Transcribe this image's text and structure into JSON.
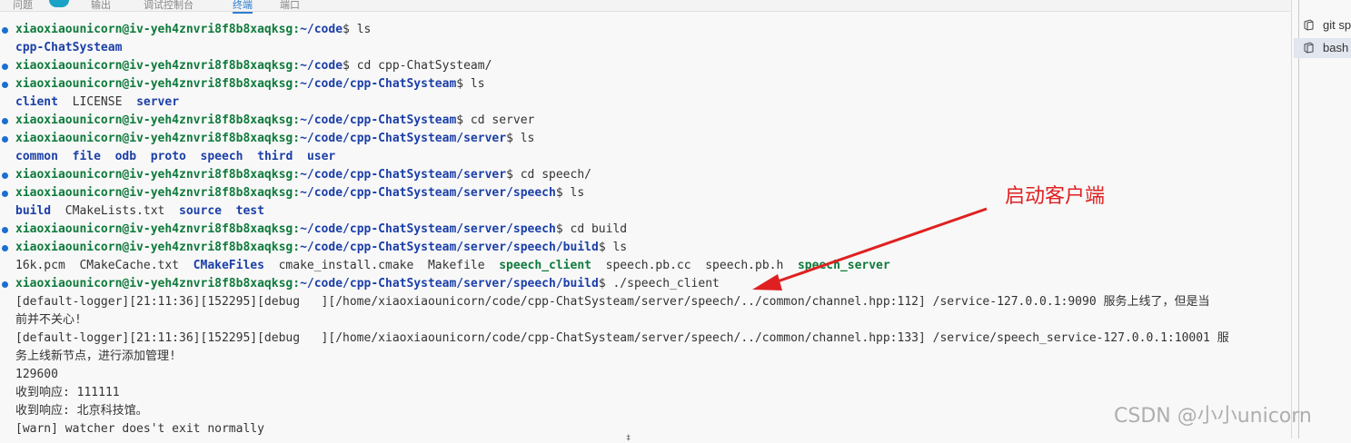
{
  "top_tabs": [
    {
      "label": "问题"
    },
    {
      "label": "输出"
    },
    {
      "label": "调试控制台"
    },
    {
      "label": "终端"
    },
    {
      "label": "端口"
    }
  ],
  "prompt": {
    "user": "xiaoxiaounicorn@iv-yeh4znvri8f8b8xaqksg",
    "sep": ":"
  },
  "lines": [
    {
      "type": "cmd",
      "path": "~/code",
      "cmd": "$ ls"
    },
    {
      "type": "out",
      "parts": [
        {
          "t": "cpp-ChatSysteam",
          "c": "dir"
        }
      ]
    },
    {
      "type": "cmd",
      "path": "~/code",
      "cmd": "$ cd cpp-ChatSysteam/"
    },
    {
      "type": "cmd",
      "path": "~/code/cpp-ChatSysteam",
      "cmd": "$ ls"
    },
    {
      "type": "out",
      "parts": [
        {
          "t": "client",
          "c": "dir"
        },
        {
          "t": "  LICENSE  ",
          "c": "plain"
        },
        {
          "t": "server",
          "c": "dir"
        }
      ]
    },
    {
      "type": "cmd",
      "path": "~/code/cpp-ChatSysteam",
      "cmd": "$ cd server"
    },
    {
      "type": "cmd",
      "path": "~/code/cpp-ChatSysteam/server",
      "cmd": "$ ls"
    },
    {
      "type": "out",
      "parts": [
        {
          "t": "common",
          "c": "dir"
        },
        {
          "t": "  ",
          "c": "plain"
        },
        {
          "t": "file",
          "c": "dir"
        },
        {
          "t": "  ",
          "c": "plain"
        },
        {
          "t": "odb",
          "c": "dir"
        },
        {
          "t": "  ",
          "c": "plain"
        },
        {
          "t": "proto",
          "c": "dir"
        },
        {
          "t": "  ",
          "c": "plain"
        },
        {
          "t": "speech",
          "c": "dir"
        },
        {
          "t": "  ",
          "c": "plain"
        },
        {
          "t": "third",
          "c": "dir"
        },
        {
          "t": "  ",
          "c": "plain"
        },
        {
          "t": "user",
          "c": "dir"
        }
      ]
    },
    {
      "type": "cmd",
      "path": "~/code/cpp-ChatSysteam/server",
      "cmd": "$ cd speech/"
    },
    {
      "type": "cmd",
      "path": "~/code/cpp-ChatSysteam/server/speech",
      "cmd": "$ ls"
    },
    {
      "type": "out",
      "parts": [
        {
          "t": "build",
          "c": "dir"
        },
        {
          "t": "  CMakeLists.txt  ",
          "c": "plain"
        },
        {
          "t": "source",
          "c": "dir"
        },
        {
          "t": "  ",
          "c": "plain"
        },
        {
          "t": "test",
          "c": "dir"
        }
      ]
    },
    {
      "type": "cmd",
      "path": "~/code/cpp-ChatSysteam/server/speech",
      "cmd": "$ cd build"
    },
    {
      "type": "cmd",
      "path": "~/code/cpp-ChatSysteam/server/speech/build",
      "cmd": "$ ls"
    },
    {
      "type": "out",
      "parts": [
        {
          "t": "16k.pcm  CMakeCache.txt  ",
          "c": "plain"
        },
        {
          "t": "CMakeFiles",
          "c": "dir"
        },
        {
          "t": "  cmake_install.cmake  Makefile  ",
          "c": "plain"
        },
        {
          "t": "speech_client",
          "c": "exec"
        },
        {
          "t": "  speech.pb.cc  speech.pb.h  ",
          "c": "plain"
        },
        {
          "t": "speech_server",
          "c": "exec"
        }
      ]
    },
    {
      "type": "cmd",
      "path": "~/code/cpp-ChatSysteam/server/speech/build",
      "cmd": "$ ./speech_client"
    },
    {
      "type": "out",
      "parts": [
        {
          "t": "[default-logger][21:11:36][152295][debug   ][/home/xiaoxiaounicorn/code/cpp-ChatSysteam/server/speech/../common/channel.hpp:112] /service-127.0.0.1:9090 服务上线了，但是当",
          "c": "plain"
        }
      ]
    },
    {
      "type": "out",
      "parts": [
        {
          "t": "前并不关心!",
          "c": "plain"
        }
      ]
    },
    {
      "type": "out",
      "parts": [
        {
          "t": "[default-logger][21:11:36][152295][debug   ][/home/xiaoxiaounicorn/code/cpp-ChatSysteam/server/speech/../common/channel.hpp:133] /service/speech_service-127.0.0.1:10001 服",
          "c": "plain"
        }
      ]
    },
    {
      "type": "out",
      "parts": [
        {
          "t": "务上线新节点，进行添加管理!",
          "c": "plain"
        }
      ]
    },
    {
      "type": "out",
      "parts": [
        {
          "t": "129600",
          "c": "plain"
        }
      ]
    },
    {
      "type": "out",
      "parts": [
        {
          "t": "收到响应: 111111",
          "c": "plain"
        }
      ]
    },
    {
      "type": "out",
      "parts": [
        {
          "t": "收到响应: 北京科技馆。",
          "c": "plain"
        }
      ]
    },
    {
      "type": "out",
      "parts": [
        {
          "t": "[warn] watcher does't exit normally",
          "c": "plain"
        }
      ]
    }
  ],
  "sidebar": {
    "items": [
      {
        "label": "git sp",
        "icon": "terminal-icon",
        "active": false
      },
      {
        "label": "bash",
        "icon": "terminal-icon",
        "active": true
      }
    ]
  },
  "annotation": {
    "text": "启动客户端",
    "color": "#e02020"
  },
  "watermark": {
    "text": "CSDN @小小unicorn"
  },
  "colors": {
    "prompt_user": "#0e7a3b",
    "prompt_path": "#1b3fa8",
    "dot": "#1a6fd1",
    "accent": "#2d7dd2"
  }
}
